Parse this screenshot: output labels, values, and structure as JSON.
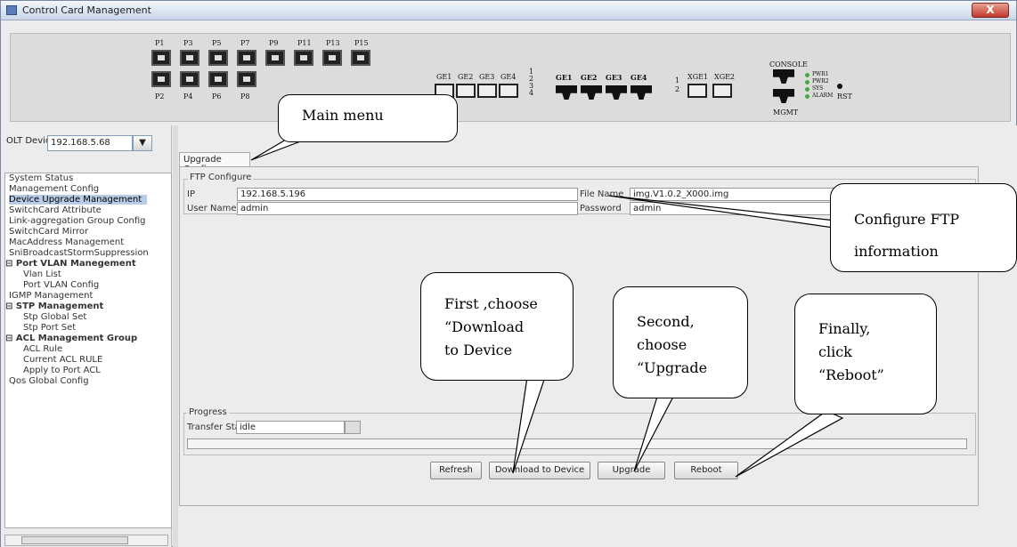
{
  "window": {
    "title": "Control Card Management",
    "close_label": "X"
  },
  "device_panel": {
    "top_labels": [
      "P1",
      "P3",
      "P5",
      "P7",
      "P9",
      "P11",
      "P13",
      "P15"
    ],
    "bottom_labels": [
      "P2",
      "P4",
      "P6",
      "P8"
    ],
    "ge_labels": [
      "GE1",
      "GE2",
      "GE3",
      "GE4"
    ],
    "ge2_labels": [
      "GE1",
      "GE2",
      "GE3",
      "GE4"
    ],
    "xge_labels": [
      "XGE1",
      "XGE2"
    ],
    "console_label": "CONSOLE",
    "mgmt_label": "MGMT",
    "led_labels": [
      "PWR1",
      "PWR2",
      "SYS",
      "ALARM"
    ],
    "rst_label": "RST",
    "ge_led_numbers": [
      "1",
      "2",
      "3",
      "4"
    ],
    "xge_led_numbers": [
      "1",
      "2"
    ]
  },
  "sidebar": {
    "olt_label": "OLT Device",
    "olt_value": "192.168.5.68",
    "items": [
      {
        "label": "System Status"
      },
      {
        "label": "Management Config"
      },
      {
        "label": "Device Upgrade Management"
      },
      {
        "label": "SwitchCard Attribute"
      },
      {
        "label": "Link-aggregation Group Config"
      },
      {
        "label": "SwitchCard Mirror"
      },
      {
        "label": "MacAddress Management"
      },
      {
        "label": "SniBroadcastStormSuppression"
      },
      {
        "label": "Port VLAN Manegement"
      },
      {
        "label": "Vlan List"
      },
      {
        "label": "Port VLAN Config"
      },
      {
        "label": "IGMP Management"
      },
      {
        "label": "STP Management"
      },
      {
        "label": "Stp Global Set"
      },
      {
        "label": "Stp Port Set"
      },
      {
        "label": "ACL Management Group"
      },
      {
        "label": "ACL Rule"
      },
      {
        "label": "Current ACL RULE"
      },
      {
        "label": "Apply to Port ACL"
      },
      {
        "label": "Qos Global Config"
      }
    ]
  },
  "main": {
    "tab_label": "Upgrade Config",
    "ftp_legend": "FTP Configure",
    "ip_label": "IP",
    "ip_value": "192.168.5.196",
    "file_label": "File Name",
    "file_value": "img.V1.0.2_X000.img",
    "user_label": "User Name",
    "user_value": "admin",
    "pass_label": "Password",
    "pass_value": "admin",
    "progress_legend": "Progress",
    "transfer_label": "Transfer Status",
    "transfer_value": "idle",
    "buttons": {
      "refresh": "Refresh",
      "download": "Download to Device",
      "upgrade": "Upgrade",
      "reboot": "Reboot"
    }
  },
  "callouts": {
    "main_menu": "Main menu",
    "ftp_info_1": "Configure    FTP",
    "ftp_info_2": "information",
    "first_1": "First ,choose",
    "first_2": "“Download",
    "first_3": "to Device",
    "second_1": "Second,",
    "second_2": "choose",
    "second_3": "“Upgrade",
    "final_1": "Finally,",
    "final_2": "click",
    "final_3": "“Reboot”"
  }
}
